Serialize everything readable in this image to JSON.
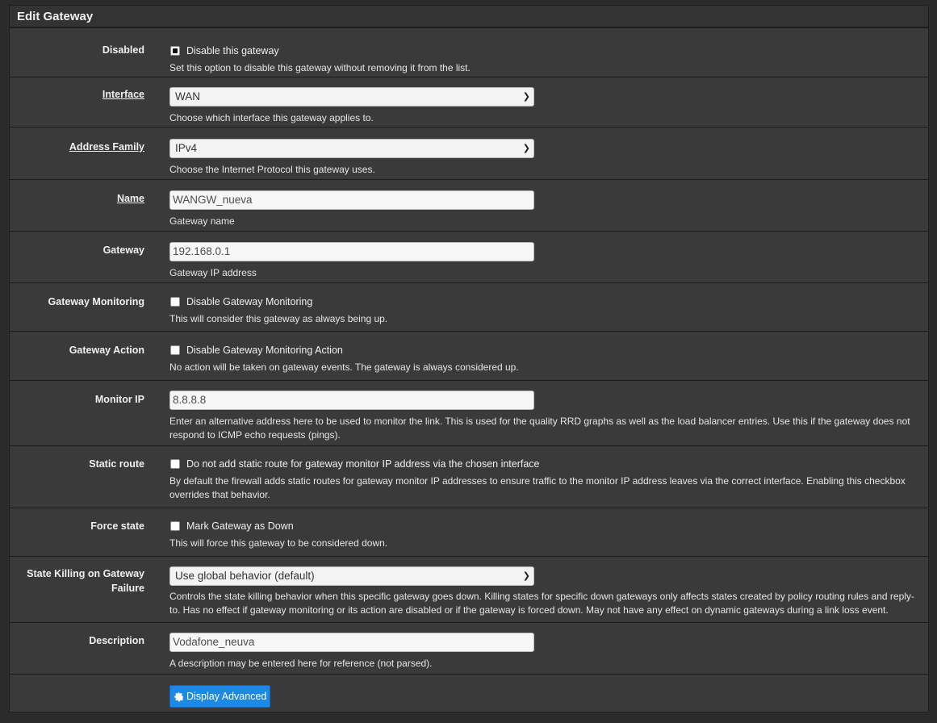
{
  "panel": {
    "title": "Edit Gateway"
  },
  "rows": {
    "disabled": {
      "label": "Disabled",
      "checkbox_label": "Disable this gateway",
      "checked": true,
      "help": "Set this option to disable this gateway without removing it from the list."
    },
    "interface": {
      "label": "Interface",
      "value": "WAN",
      "help": "Choose which interface this gateway applies to."
    },
    "address_family": {
      "label": "Address Family",
      "value": "IPv4",
      "help": "Choose the Internet Protocol this gateway uses."
    },
    "name": {
      "label": "Name",
      "value": "WANGW_nueva",
      "help": "Gateway name"
    },
    "gateway": {
      "label": "Gateway",
      "value": "192.168.0.1",
      "help": "Gateway IP address"
    },
    "gateway_monitoring": {
      "label": "Gateway Monitoring",
      "checkbox_label": "Disable Gateway Monitoring",
      "checked": false,
      "help": "This will consider this gateway as always being up."
    },
    "gateway_action": {
      "label": "Gateway Action",
      "checkbox_label": "Disable Gateway Monitoring Action",
      "checked": false,
      "help": "No action will be taken on gateway events. The gateway is always considered up."
    },
    "monitor_ip": {
      "label": "Monitor IP",
      "value": "8.8.8.8",
      "help": "Enter an alternative address here to be used to monitor the link. This is used for the quality RRD graphs as well as the load balancer entries. Use this if the gateway does not respond to ICMP echo requests (pings)."
    },
    "static_route": {
      "label": "Static route",
      "checkbox_label": "Do not add static route for gateway monitor IP address via the chosen interface",
      "checked": false,
      "help": "By default the firewall adds static routes for gateway monitor IP addresses to ensure traffic to the monitor IP address leaves via the correct interface. Enabling this checkbox overrides that behavior."
    },
    "force_state": {
      "label": "Force state",
      "checkbox_label": "Mark Gateway as Down",
      "checked": false,
      "help": "This will force this gateway to be considered down."
    },
    "state_killing": {
      "label": "State Killing on Gateway Failure",
      "value": "Use global behavior (default)",
      "help": "Controls the state killing behavior when this specific gateway goes down. Killing states for specific down gateways only affects states created by policy routing rules and reply-to. Has no effect if gateway monitoring or its action are disabled or if the gateway is forced down. May not have any effect on dynamic gateways during a link loss event."
    },
    "description": {
      "label": "Description",
      "value": "Vodafone_neuva",
      "help": "A description may be entered here for reference (not parsed)."
    }
  },
  "buttons": {
    "display_advanced": "Display Advanced"
  },
  "icons": {
    "advanced": "gear-icon",
    "dropdown": "chevron-down-icon"
  },
  "colors": {
    "accent": "#1e88e5",
    "panel_bg": "#3a3a3a",
    "page_bg": "#2b2b2b"
  }
}
